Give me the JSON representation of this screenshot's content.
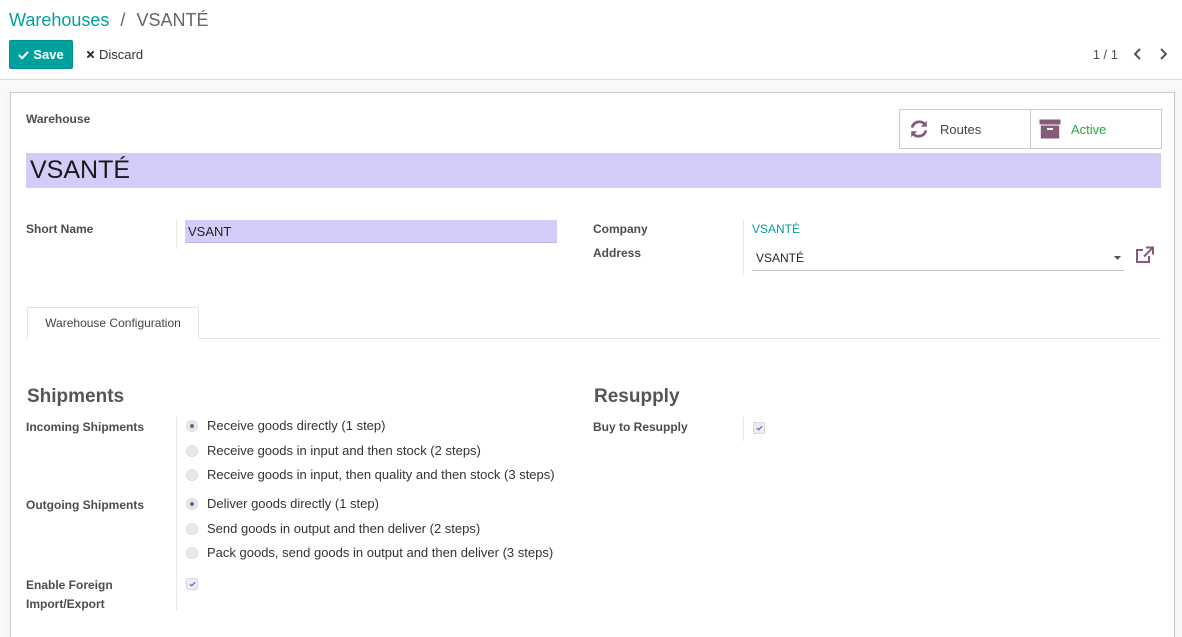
{
  "breadcrumb": {
    "parent": "Warehouses",
    "separator": "/",
    "current": "VSANTÉ"
  },
  "toolbar": {
    "save_label": "Save",
    "discard_label": "Discard"
  },
  "pager": {
    "value": "1 / 1"
  },
  "smart_buttons": {
    "routes_label": "Routes",
    "active_label": "Active"
  },
  "form": {
    "warehouse_label": "Warehouse",
    "name_value": "VSANTÉ",
    "short_name_label": "Short Name",
    "short_name_value": "VSANT",
    "company_label": "Company",
    "company_value": "VSANTÉ",
    "address_label": "Address",
    "address_value": "VSANTÉ"
  },
  "tabs": [
    {
      "label": "Warehouse Configuration",
      "active": true
    }
  ],
  "shipments": {
    "title": "Shipments",
    "incoming_label": "Incoming Shipments",
    "incoming_options": [
      {
        "label": "Receive goods directly (1 step)",
        "checked": true
      },
      {
        "label": "Receive goods in input and then stock (2 steps)",
        "checked": false
      },
      {
        "label": "Receive goods in input, then quality and then stock (3 steps)",
        "checked": false
      }
    ],
    "outgoing_label": "Outgoing Shipments",
    "outgoing_options": [
      {
        "label": "Deliver goods directly (1 step)",
        "checked": true
      },
      {
        "label": "Send goods in output and then deliver (2 steps)",
        "checked": false
      },
      {
        "label": "Pack goods, send goods in output and then deliver (3 steps)",
        "checked": false
      }
    ],
    "foreign_label_line1": "Enable Foreign",
    "foreign_label_line2": "Import/Export",
    "foreign_checked": true
  },
  "resupply": {
    "title": "Resupply",
    "buy_label": "Buy to Resupply",
    "buy_checked": true
  },
  "colors": {
    "accent": "#00a09d",
    "field_bg": "#d2ccf8",
    "active_green": "#28a745",
    "icon_purple": "#875a7b"
  }
}
